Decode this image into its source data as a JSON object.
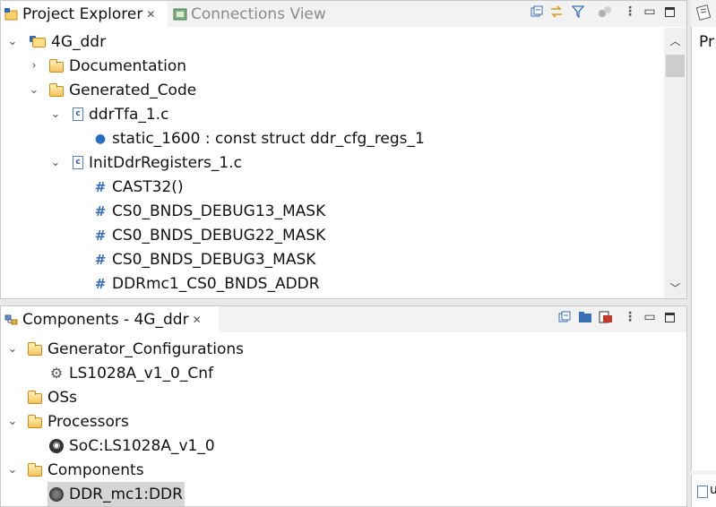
{
  "project_explorer": {
    "tabs": [
      {
        "label": "Project Explorer",
        "active": true,
        "icon": "project-explorer-icon"
      },
      {
        "label": "Connections View",
        "active": false,
        "icon": "connections-view-icon"
      }
    ],
    "toolbar_icons": [
      "collapse-all-icon",
      "link-with-editor-icon",
      "filter-icon",
      "sync-icon",
      "view-menu-icon",
      "minimize-icon",
      "maximize-icon"
    ],
    "tree": [
      {
        "label": "4G_ddr",
        "icon": "project-icon",
        "expanded": true,
        "level": 0
      },
      {
        "label": "Documentation",
        "icon": "folder-icon",
        "expanded": false,
        "level": 1
      },
      {
        "label": "Generated_Code",
        "icon": "folder-icon",
        "expanded": true,
        "level": 1
      },
      {
        "label": "ddrTfa_1.c",
        "icon": "c-file-icon",
        "expanded": true,
        "level": 2
      },
      {
        "label": "static_1600 : const struct ddr_cfg_regs_1",
        "icon": "variable-icon",
        "level": 3
      },
      {
        "label": "InitDdrRegisters_1.c",
        "icon": "c-file-icon",
        "expanded": true,
        "level": 2
      },
      {
        "label": "CAST32()",
        "icon": "macro-icon",
        "level": 3
      },
      {
        "label": "CS0_BNDS_DEBUG13_MASK",
        "icon": "macro-icon",
        "level": 3
      },
      {
        "label": "CS0_BNDS_DEBUG22_MASK",
        "icon": "macro-icon",
        "level": 3
      },
      {
        "label": "CS0_BNDS_DEBUG3_MASK",
        "icon": "macro-icon",
        "level": 3
      },
      {
        "label": "DDRmc1_CS0_BNDS_ADDR",
        "icon": "macro-icon",
        "level": 3
      }
    ]
  },
  "components": {
    "tab_label": "Components - 4G_ddr",
    "toolbar_icons": [
      "collapse-all-icon",
      "open-folder-icon",
      "add-component-icon",
      "view-menu-icon",
      "minimize-icon",
      "maximize-icon"
    ],
    "tree": [
      {
        "label": "Generator_Configurations",
        "icon": "folder-icon",
        "expanded": true,
        "level": 0
      },
      {
        "label": "LS1028A_v1_0_Cnf",
        "icon": "gear-icon",
        "level": 1
      },
      {
        "label": "OSs",
        "icon": "folder-icon",
        "level": 0
      },
      {
        "label": "Processors",
        "icon": "folder-icon",
        "expanded": true,
        "level": 0
      },
      {
        "label": "SoC:LS1028A_v1_0",
        "icon": "chip-icon",
        "level": 1
      },
      {
        "label": "Components",
        "icon": "folder-icon",
        "expanded": true,
        "level": 0
      },
      {
        "label": "DDR_mc1:DDR",
        "icon": "component-icon",
        "level": 1,
        "selected": true
      }
    ]
  },
  "right_panel": {
    "text_top": "Pr",
    "text_bottom": "u"
  }
}
